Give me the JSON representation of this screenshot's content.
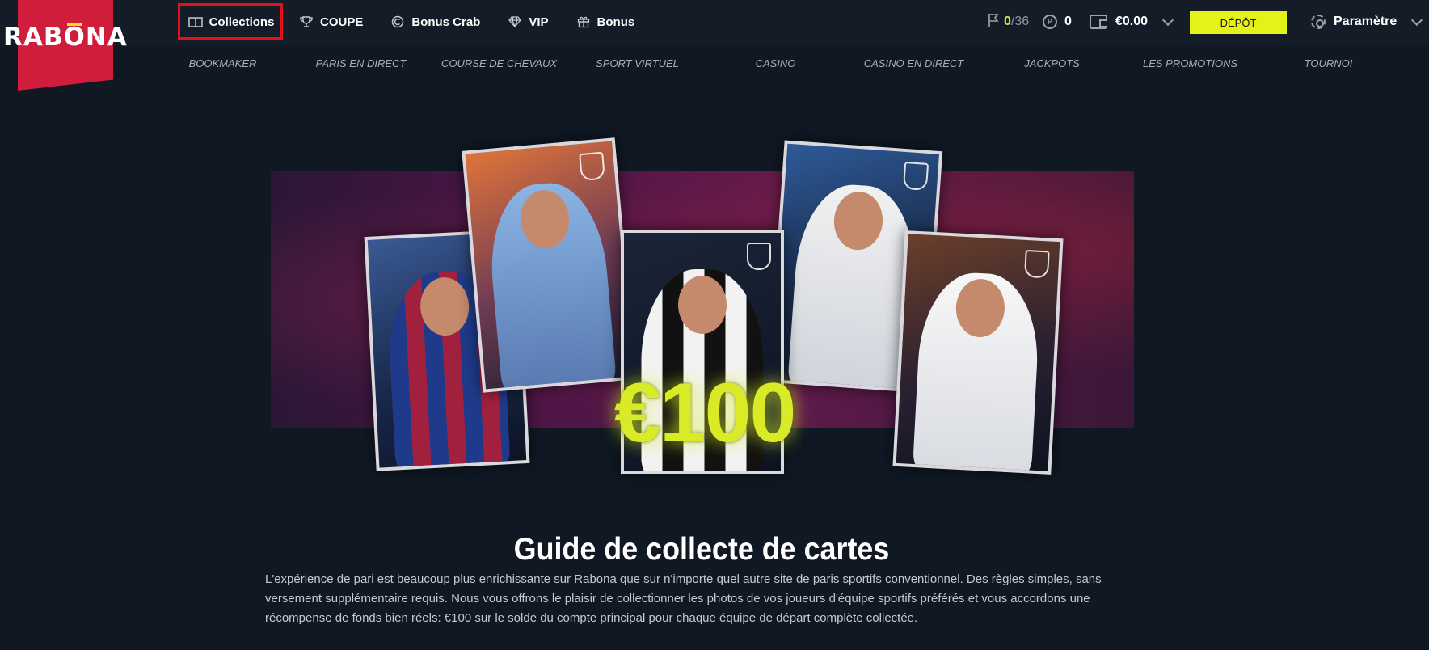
{
  "logo": {
    "text_left": "RAB",
    "text_mark": "O",
    "text_right": "NA"
  },
  "top_tabs": [
    {
      "label": "Collections",
      "icon": "book-icon"
    },
    {
      "label": "COUPE",
      "icon": "trophy-icon"
    },
    {
      "label": "Bonus Crab",
      "icon": "coin-icon"
    },
    {
      "label": "VIP",
      "icon": "diamond-icon"
    },
    {
      "label": "Bonus",
      "icon": "gift-icon"
    }
  ],
  "header": {
    "level_current": "0",
    "level_total": "/36",
    "points_icon": "P",
    "points_value": "0",
    "balance": "€0.00",
    "deposit_label": "DÉPÔT",
    "settings_label": "Paramètre"
  },
  "main_nav": [
    "BOOKMAKER",
    "PARIS EN DIRECT",
    "COURSE DE CHEVAUX",
    "SPORT VIRTUEL",
    "CASINO",
    "CASINO EN DIRECT",
    "JACKPOTS",
    "LES PROMOTIONS",
    "TOURNOI"
  ],
  "banner": {
    "prize_text": "€100"
  },
  "guide": {
    "title": "Guide de collecte de cartes",
    "body": "L'expérience de pari est beaucoup plus enrichissante sur Rabona que sur n'importe quel autre site de paris sportifs conventionnel. Des règles simples, sans versement supplémentaire requis. Nous vous offrons le plaisir de collectionner les photos de vos joueurs d'équipe sportifs préférés et vous accordons une récompense de fonds bien réels: €100 sur le solde du compte principal pour chaque équipe de départ complète collectée."
  },
  "colors": {
    "accent": "#e5f218",
    "brand_red": "#d01d3c",
    "background": "#0f1823",
    "highlight_box": "#e4111b"
  }
}
